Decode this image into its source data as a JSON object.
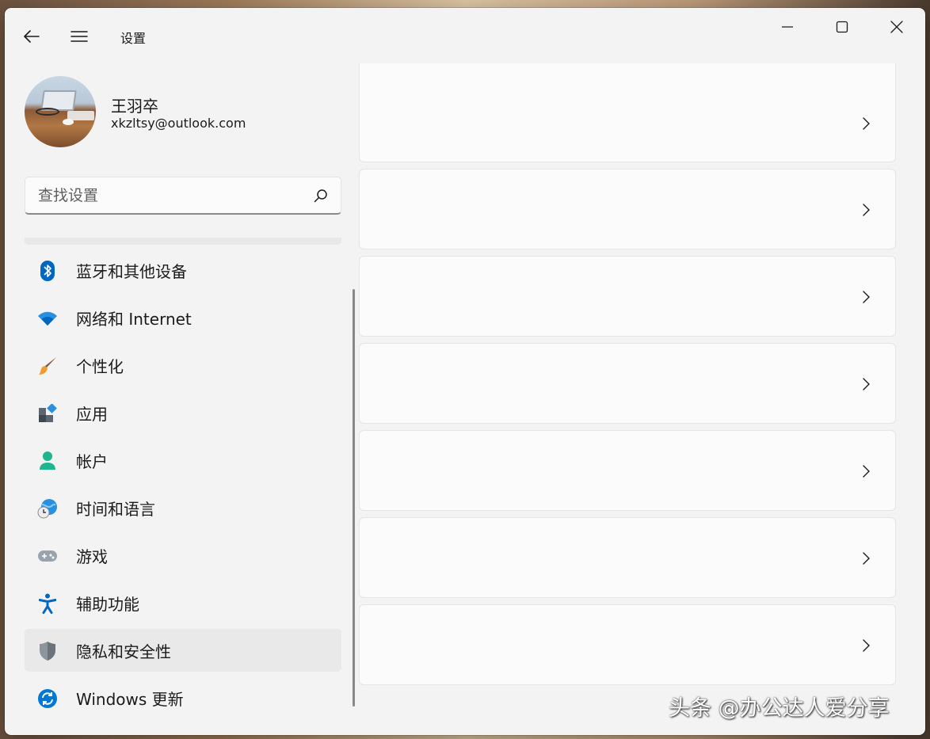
{
  "window": {
    "title": "设置"
  },
  "profile": {
    "name": "王羽卒",
    "email": "xkzltsy@outlook.com"
  },
  "search": {
    "placeholder": "查找设置"
  },
  "nav": {
    "items": [
      {
        "label": "蓝牙和其他设备",
        "icon": "bluetooth-icon"
      },
      {
        "label": "网络和 Internet",
        "icon": "wifi-icon"
      },
      {
        "label": "个性化",
        "icon": "paintbrush-icon"
      },
      {
        "label": "应用",
        "icon": "apps-icon"
      },
      {
        "label": "帐户",
        "icon": "account-icon"
      },
      {
        "label": "时间和语言",
        "icon": "globe-clock-icon"
      },
      {
        "label": "游戏",
        "icon": "gamepad-icon"
      },
      {
        "label": "辅助功能",
        "icon": "accessibility-icon"
      },
      {
        "label": "隐私和安全性",
        "icon": "shield-icon",
        "selected": true
      },
      {
        "label": "Windows 更新",
        "icon": "windows-update-icon"
      }
    ]
  },
  "content": {
    "cards_count_visible": 7
  },
  "watermark": {
    "text": "头条 @办公达人爱分享"
  },
  "colors": {
    "window_bg": "#f3f3f3",
    "card_bg": "#fbfbfb",
    "selected_bg": "#e9e9e9",
    "accent_blue": "#0067c0"
  }
}
